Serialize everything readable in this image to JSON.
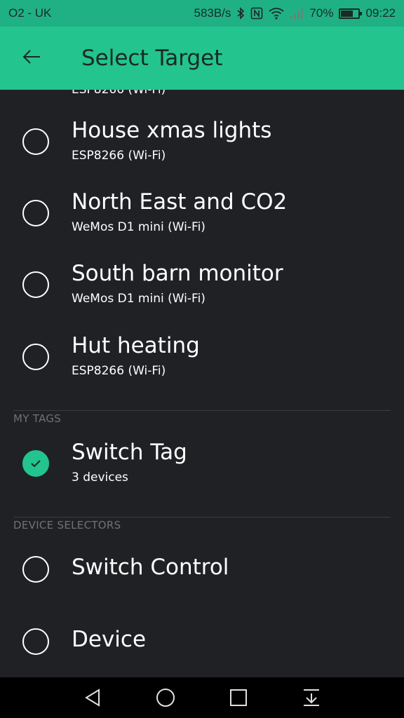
{
  "status_bar": {
    "carrier": "O2 - UK",
    "speed": "583B/s",
    "battery_percent": "70%",
    "battery_level": 0.7,
    "time": "09:22",
    "icons": [
      "bluetooth-icon",
      "nfc-icon",
      "wifi-icon",
      "signal-icon",
      "battery-icon"
    ]
  },
  "app_bar": {
    "title": "Select Target",
    "back_icon": "arrow-left-icon"
  },
  "clipped_item": {
    "subtitle": "ESP8266 (Wi-Fi)"
  },
  "devices": [
    {
      "title": "House xmas lights",
      "subtitle": "ESP8266 (Wi-Fi)",
      "selected": false
    },
    {
      "title": "North East and CO2",
      "subtitle": "WeMos D1 mini (Wi-Fi)",
      "selected": false
    },
    {
      "title": "South barn monitor",
      "subtitle": "WeMos D1 mini (Wi-Fi)",
      "selected": false
    },
    {
      "title": "Hut heating",
      "subtitle": "ESP8266 (Wi-Fi)",
      "selected": false
    }
  ],
  "tags_section": {
    "header": "MY TAGS",
    "items": [
      {
        "title": "Switch Tag",
        "subtitle": "3 devices",
        "selected": true
      }
    ]
  },
  "selectors_section": {
    "header": "DEVICE SELECTORS",
    "items": [
      {
        "title": "Switch Control",
        "selected": false
      },
      {
        "title": "Device",
        "selected": false
      }
    ]
  },
  "nav_bar": {
    "icons": [
      "back-triangle-icon",
      "home-circle-icon",
      "recents-square-icon",
      "notification-pull-icon"
    ]
  },
  "colors": {
    "accent": "#23c48e",
    "status_bar": "#1fb184",
    "background": "#202124",
    "section_header": "#6e7176"
  }
}
